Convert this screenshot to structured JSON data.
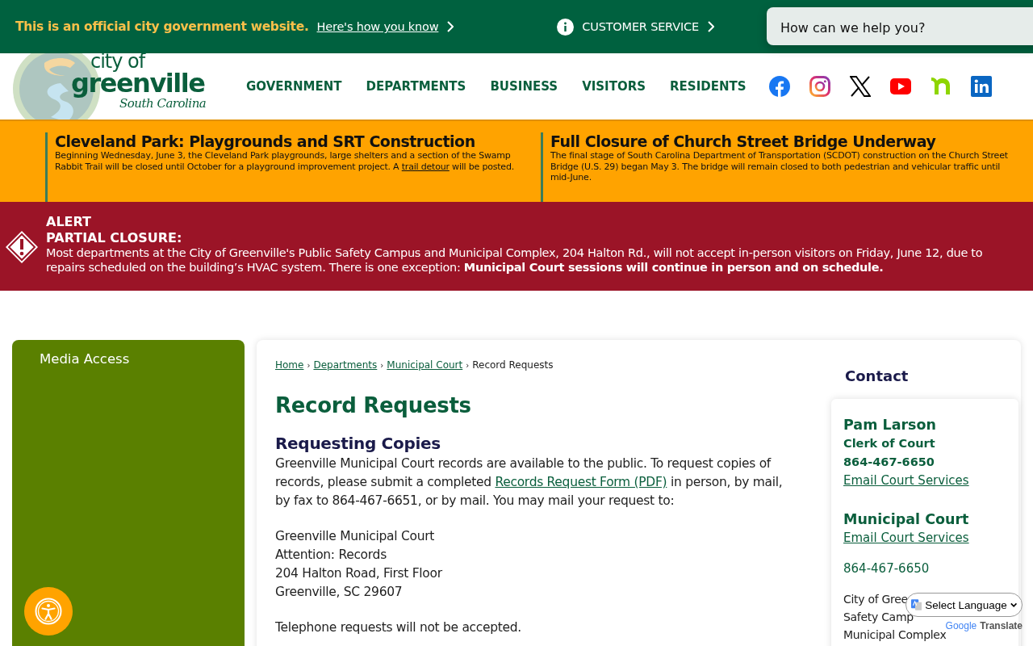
{
  "top_bar": {
    "official_text": "This is an official city government website.",
    "how_you_know": "Here's how you know",
    "customer_service": "CUSTOMER SERVICE",
    "search": {
      "placeholder": "How can we help you?"
    }
  },
  "logo": {
    "line1": "city of",
    "line2": "greenville",
    "line3": "South Carolina"
  },
  "nav": [
    "GOVERNMENT",
    "DEPARTMENTS",
    "BUSINESS",
    "VISITORS",
    "RESIDENTS"
  ],
  "social": [
    {
      "kind": "facebook"
    },
    {
      "kind": "instagram"
    },
    {
      "kind": "x"
    },
    {
      "kind": "youtube"
    },
    {
      "kind": "nextdoor"
    },
    {
      "kind": "linkedin"
    }
  ],
  "news": [
    {
      "title": "Cleveland Park: Playgrounds and SRT Construction",
      "body": "Beginning Wednesday, June 3, the Cleveland Park playgrounds, large shelters and a section of the Swamp Rabbit Trail will be closed until October for a playground improvement project. A",
      "link": "trail detour",
      "body_after": "will be posted."
    },
    {
      "title": "Full Closure of Church Street Bridge Underway",
      "body": "The final stage of South Carolina Department of Transportation (SCDOT) construction on the Church Street Bridge (U.S. 29) began May 3. The bridge will remain closed to both pedestrian and vehicular traffic until mid-June."
    }
  ],
  "alert": {
    "label": "ALERT",
    "heading": "PARTIAL CLOSURE:",
    "text": "Most departments at the City of Greenville's Public Safety Campus and Municipal Complex, 204 Halton Rd., will not accept in-person visitors on Friday, June 12, due to repairs scheduled on the building’s HVAC system. There is one exception: **Municipal Court sessions will continue in person and on schedule.**"
  },
  "sidebar": {
    "items": [
      "Media Access"
    ]
  },
  "breadcrumb": [
    {
      "label": "Home",
      "kind": "link",
      "separator": "›"
    },
    {
      "label": "Departments",
      "kind": "link",
      "separator": "›"
    },
    {
      "label": "Municipal Court",
      "kind": "link",
      "separator": "›"
    },
    {
      "label": "Record Requests",
      "kind": "current"
    }
  ],
  "page_title": "Record Requests",
  "section_heading": "Requesting Copies",
  "paragraph": {
    "before": "Greenville Municipal Court records are available to the public. To request copies of records, please submit a completed",
    "link": "Records Request Form (PDF)",
    "after": "in person, by mail, by fax to 864-467-6651, or by mail. You may mail your request to:"
  },
  "address_lines": [
    "Greenville Municipal Court",
    "Attention: Records",
    "204 Halton Road, First Floor",
    "Greenville, SC 29607"
  ],
  "note": "Telephone requests will not be accepted.",
  "contact": {
    "heading": "Contact",
    "person": {
      "name": "Pam Larson",
      "title": "Clerk of Court",
      "phone": "864-467-6650",
      "email": "Email Court Services"
    },
    "office": {
      "name": "Municipal Court",
      "email": "Email Court Services",
      "phone": "864-467-6650",
      "address_lines": [
        "City of Gree",
        "Safety Camp",
        "Municipal Complex"
      ]
    }
  },
  "translate": {
    "select": "Select Language",
    "brand": "Google",
    "label": "Translate"
  }
}
